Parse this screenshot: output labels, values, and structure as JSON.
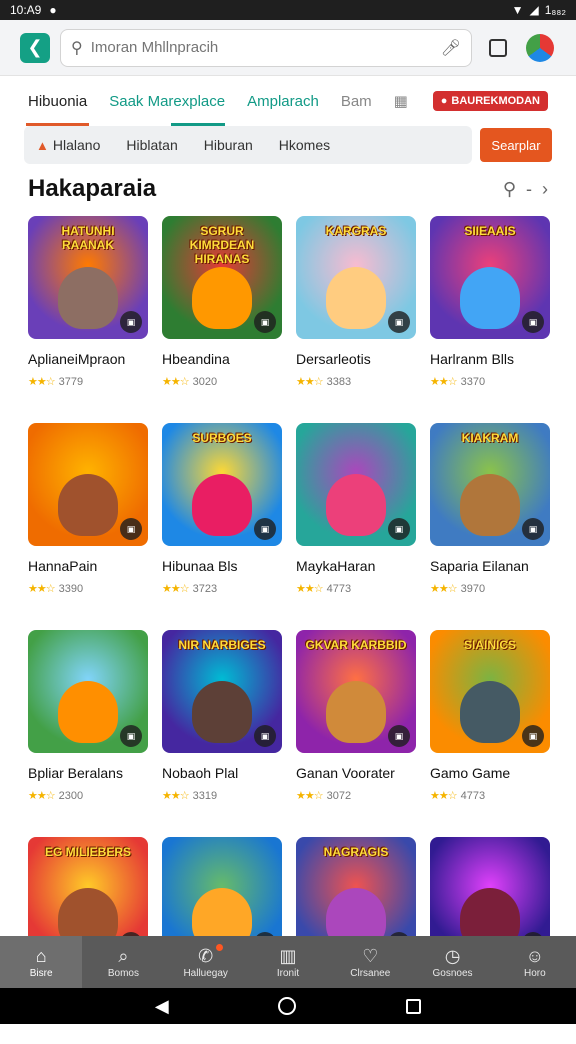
{
  "status_bar": {
    "time": "10:A9",
    "battery": "1₈₈₂"
  },
  "search": {
    "placeholder": "Imoran Mhllnpracih"
  },
  "tabs": [
    {
      "label": "Hibuonia"
    },
    {
      "label": "Saak Marexplace"
    },
    {
      "label": "Amplarach"
    },
    {
      "label": "Bam"
    }
  ],
  "brand_badge": "BAUREKMODAN",
  "filters": [
    {
      "label": "Hlalano"
    },
    {
      "label": "Hiblatan"
    },
    {
      "label": "Hiburan"
    },
    {
      "label": "Hkomes"
    }
  ],
  "search_button": "Searplar",
  "section": {
    "title": "Hakaparaia"
  },
  "apps": [
    {
      "name": "AplianeiMpraon",
      "rating": "3779",
      "banner": "HATUNHI RAANAK",
      "bg": "#6a3fb8",
      "accent": "#ff7a00",
      "char": "#8d6e63",
      "stars": "★★☆"
    },
    {
      "name": "Hbeandina",
      "rating": "3020",
      "banner": "SGRUR KIMRDEAN HIRANAS",
      "bg": "#2e7d32",
      "accent": "#e53935",
      "char": "#ff9800",
      "stars": "★★☆"
    },
    {
      "name": "Dersarleotis",
      "rating": "3383",
      "banner": "KARGRAS",
      "bg": "#7ec8e3",
      "accent": "#f8bbd0",
      "char": "#ffcc80",
      "stars": "★★☆"
    },
    {
      "name": "Harlranm Blls",
      "rating": "3370",
      "banner": "SIIEAAIS",
      "bg": "#5e35b1",
      "accent": "#ec407a",
      "char": "#42a5f5",
      "stars": "★★☆"
    },
    {
      "name": "HannaPain",
      "rating": "3390",
      "banner": "",
      "bg": "#ef6c00",
      "accent": "#ffb300",
      "char": "#a0522d",
      "stars": "★★☆"
    },
    {
      "name": "Hibunaa Bls",
      "rating": "3723",
      "banner": "SURBOES",
      "bg": "#1e88e5",
      "accent": "#fdd835",
      "char": "#e91e63",
      "stars": "★★☆"
    },
    {
      "name": "MaykaHaran",
      "rating": "4773",
      "banner": "",
      "bg": "#26a69a",
      "accent": "#ab47bc",
      "char": "#ec407a",
      "stars": "★★☆"
    },
    {
      "name": "Saparia Eilanan",
      "rating": "3970",
      "banner": "KIAKRAM",
      "bg": "#3f7bc2",
      "accent": "#8bc34a",
      "char": "#b0763b",
      "stars": "★★☆"
    },
    {
      "name": "Bpliar Beralans",
      "rating": "2300",
      "banner": "",
      "bg": "#43a047",
      "accent": "#81d4fa",
      "char": "#ff8f00",
      "stars": "★★☆"
    },
    {
      "name": "Nobaoh Plal",
      "rating": "3319",
      "banner": "NIR NARBIGES",
      "bg": "#4527a0",
      "accent": "#00bcd4",
      "char": "#5d4037",
      "stars": "★★☆"
    },
    {
      "name": "Ganan Voorater",
      "rating": "3072",
      "banner": "GKVAR KARBBID",
      "bg": "#8e24aa",
      "accent": "#ff7043",
      "char": "#d08a3a",
      "stars": "★★☆"
    },
    {
      "name": "Gamo Game",
      "rating": "4773",
      "banner": "SIAINICS",
      "bg": "#fb8c00",
      "accent": "#7cb342",
      "char": "#455a64",
      "stars": "★★☆"
    },
    {
      "name": "",
      "rating": "",
      "banner": "EG MILIEBERS",
      "bg": "#e53935",
      "accent": "#ffca28",
      "char": "#a0522d",
      "stars": ""
    },
    {
      "name": "",
      "rating": "",
      "banner": "",
      "bg": "#1976d2",
      "accent": "#66bb6a",
      "char": "#ffa726",
      "stars": ""
    },
    {
      "name": "",
      "rating": "",
      "banner": "NAGRAGIS",
      "bg": "#3949ab",
      "accent": "#ef5350",
      "char": "#ab47bc",
      "stars": ""
    },
    {
      "name": "",
      "rating": "",
      "banner": "",
      "bg": "#311b92",
      "accent": "#e040fb",
      "char": "#7b1f3a",
      "stars": ""
    }
  ],
  "bottom_nav": [
    {
      "label": "Bisre",
      "icon": "home-icon"
    },
    {
      "label": "Bomos",
      "icon": "search-icon"
    },
    {
      "label": "Halluegay",
      "icon": "bubble-icon"
    },
    {
      "label": "Ironit",
      "icon": "book-icon"
    },
    {
      "label": "Clrsanee",
      "icon": "heart-icon"
    },
    {
      "label": "Gosnoes",
      "icon": "clock-icon"
    },
    {
      "label": "Horo",
      "icon": "person-icon"
    }
  ],
  "colors": {
    "accent_orange": "#e4561f",
    "accent_teal": "#129a86",
    "star": "#f5b400"
  }
}
